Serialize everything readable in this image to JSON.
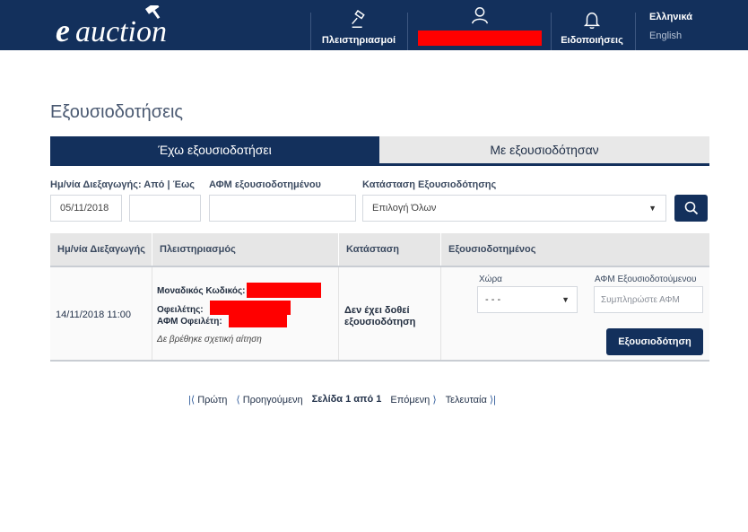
{
  "header": {
    "logo_text": "eauction",
    "nav": {
      "auctions_label": "Πλειστηριασμοί",
      "account_label": "",
      "notifications_label": "Ειδοποιήσεις"
    },
    "languages": [
      "Ελληνικά",
      "English"
    ]
  },
  "page": {
    "title": "Εξουσιοδοτήσεις"
  },
  "tabs": [
    {
      "label": "Έχω εξουσιοδοτήσει",
      "active": true
    },
    {
      "label": "Με εξουσιοδότησαν",
      "active": false
    }
  ],
  "filters": {
    "date_label": "Ημ/νία Διεξαγωγής: Από | Έως",
    "date_from_value": "05/11/2018",
    "date_to_value": "",
    "afm_label": "ΑΦΜ εξουσιοδοτημένου",
    "afm_value": "",
    "status_label": "Κατάσταση Εξουσιοδότησης",
    "status_value": "Επιλογή Όλων"
  },
  "table": {
    "columns": [
      "Ημ/νία Διεξαγωγής",
      "Πλειστηριασμός",
      "Κατάσταση",
      "Εξουσιοδοτημένος"
    ],
    "rows": [
      {
        "date": "14/11/2018 11:00",
        "unique_code_label": "Μοναδικός Κωδικός:",
        "debtor_label": "Οφειλέτης:",
        "debtor_afm_label": "ΑΦΜ Οφειλέτη:",
        "note": "Δε βρέθηκε σχετική αίτηση",
        "status": "Δεν έχει δοθεί εξουσιοδότηση",
        "country_label": "Χώρα",
        "country_value": "- - -",
        "afm_label": "ΑΦΜ Εξουσιοδοτούμενου",
        "afm_placeholder": "Συμπληρώστε ΑΦΜ",
        "authorize_button": "Εξουσιοδότηση"
      }
    ]
  },
  "pagination": {
    "first": "Πρώτη",
    "previous": "Προηγούμενη",
    "current": "Σελίδα 1 από 1",
    "next": "Επόμενη",
    "last": "Τελευταία"
  },
  "colors": {
    "primary": "#13305c",
    "redaction": "#ff0000"
  }
}
